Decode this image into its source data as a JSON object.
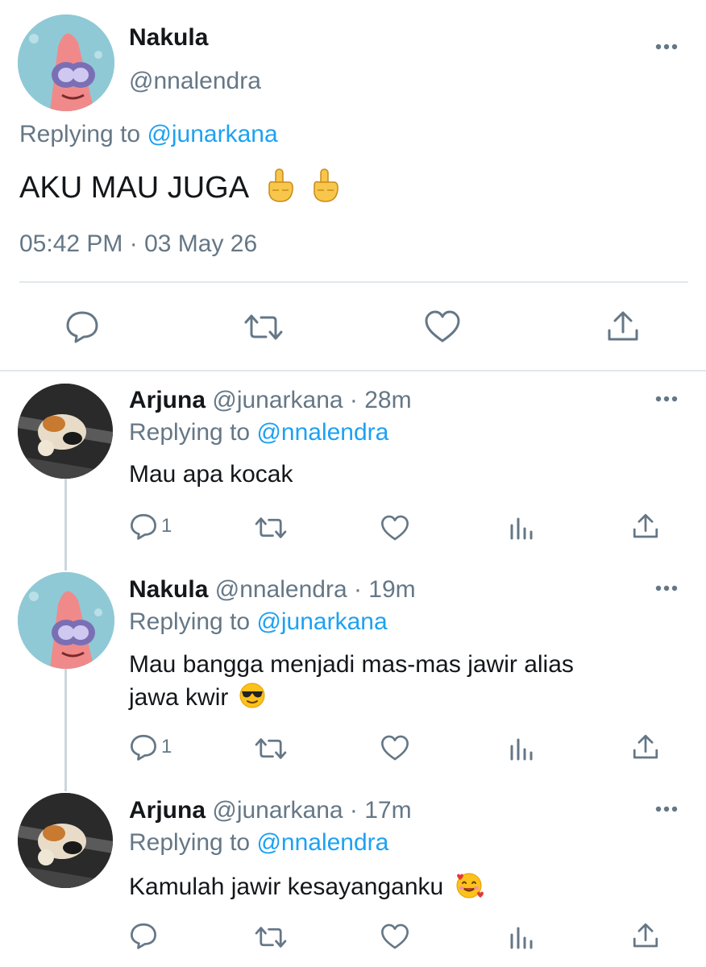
{
  "main_tweet": {
    "name": "Nakula",
    "handle": "@nnalendra",
    "replying_prefix": "Replying to",
    "replying_to": "@junarkana",
    "text": "AKU MAU JUGA",
    "emoji": [
      "pointing-up-emoji",
      "pointing-up-emoji"
    ],
    "timestamp": "05:42 PM · 03 May 26"
  },
  "replies": [
    {
      "name": "Arjuna",
      "handle": "@junarkana",
      "time": "· 28m",
      "replying_prefix": "Replying to",
      "replying_to": "@nnalendra",
      "text": "Mau apa kocak",
      "reply_count": "1"
    },
    {
      "name": "Nakula",
      "handle": "@nnalendra",
      "time": "· 19m",
      "replying_prefix": "Replying to",
      "replying_to": "@junarkana",
      "text_line1": "Mau bangga menjadi mas-mas jawir alias",
      "text_line2": "jawa kwir",
      "emoji": "sunglasses-emoji",
      "reply_count": "1"
    },
    {
      "name": "Arjuna",
      "handle": "@junarkana",
      "time": "· 17m",
      "replying_prefix": "Replying to",
      "replying_to": "@nnalendra",
      "text": "Kamulah jawir kesayanganku",
      "emoji": "smiling-face-with-hearts-emoji",
      "reply_count": ""
    }
  ],
  "colors": {
    "link": "#1da1f2",
    "secondary": "#657786",
    "divider": "#e1e8ed"
  }
}
